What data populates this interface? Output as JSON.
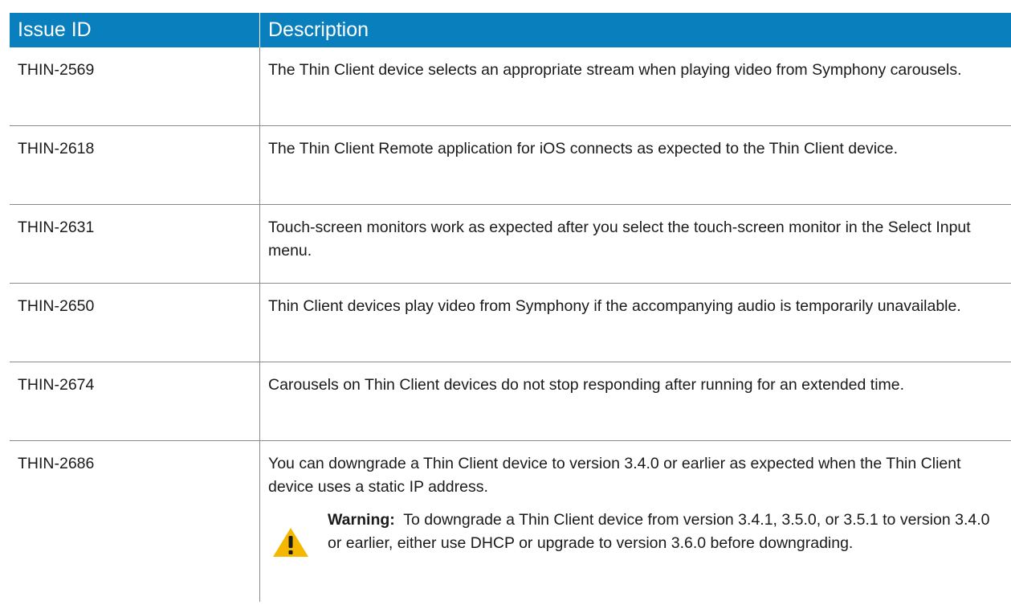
{
  "table": {
    "headers": {
      "issue_id": "Issue ID",
      "description": "Description"
    },
    "rows": [
      {
        "id": "THIN-2569",
        "description": "The Thin Client device selects an appropriate stream when playing video from Symphony carousels."
      },
      {
        "id": "THIN-2618",
        "description": "The Thin Client Remote application for iOS connects as expected to the Thin Client device."
      },
      {
        "id": "THIN-2631",
        "description": "Touch-screen monitors work as expected after you select the touch-screen monitor in the Select Input menu."
      },
      {
        "id": "THIN-2650",
        "description": "Thin Client devices play video from Symphony if the accompanying audio is temporarily unavailable."
      },
      {
        "id": "THIN-2674",
        "description": "Carousels on Thin Client devices do not stop responding after running for an extended time."
      },
      {
        "id": "THIN-2686",
        "description": "You can downgrade a Thin Client device to version 3.4.0 or earlier as expected when the Thin Client device uses a static IP address.",
        "warning": {
          "label": "Warning:",
          "text": "To downgrade a Thin Client device from version 3.4.1, 3.5.0, or 3.5.1 to version 3.4.0 or earlier, either use DHCP or upgrade to version 3.6.0 before downgrading.",
          "icon": "warning-triangle-icon"
        }
      }
    ]
  },
  "colors": {
    "header_bg": "#0a7fbd",
    "header_text": "#ffffff",
    "border": "#8a8a8a",
    "warning_yellow": "#f5b800"
  }
}
